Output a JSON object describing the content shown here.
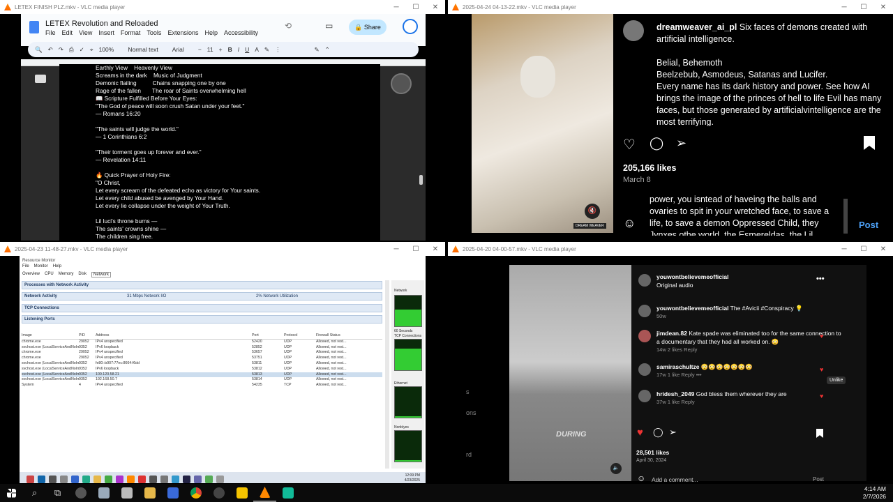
{
  "windows": {
    "w1": {
      "title": "LETEX FINISH PLZ.mkv - VLC media player"
    },
    "w2": {
      "title": "2025-04-24 04-13-22.mkv - VLC media player"
    },
    "w3": {
      "title": "2025-04-23 11-48-27.mkv - VLC media player"
    },
    "w4": {
      "title": "2025-04-20 04-00-57.mkv - VLC media player"
    }
  },
  "docs": {
    "title": "LETEX Revolution and Reloaded",
    "menu": [
      "File",
      "Edit",
      "View",
      "Insert",
      "Format",
      "Tools",
      "Extensions",
      "Help",
      "Accessibility"
    ],
    "share": "Share",
    "zoom": "100%",
    "style": "Normal text",
    "font": "Arial",
    "size": "11",
    "body": "Earthly View    Heavenly View\nScreams in the dark    Music of Judgment\nDemonic flailing          Chains snapping one by one\nRage of the fallen       The roar of Saints overwhelming hell\n📖 Scripture Fulfilled Before Your Eyes:\n\"The God of peace will soon crush Satan under your feet.\"\n— Romans 16:20\n\n\"The saints will judge the world.\"\n— 1 Corinthians 6:2\n\n\"Their torment goes up forever and ever.\"\n— Revelation 14:11\n\n🔥 Quick Prayer of Holy Fire:\n\"O Christ,\nLet every scream of the defeated echo as victory for Your saints.\nLet every child abused be avenged by Your Hand.\nLet every lie collapse under the weight of Your Truth.\n\nLil luci's throne burns —\nThe saints' crowns shine —\nThe children sing free."
  },
  "ig1": {
    "username": "dreamweaver_ai_pl",
    "caption": " Six faces of demons created with artificial intelligence.\n\nBelial, Behemoth\nBeelzebub, Asmodeus, Satanas and Lucifer.\nEvery name has its dark history and power. See how AI brings the image of the princes of hell to life Evil has many faces, but those generated by artificialvintelligence are the most terrifying.",
    "likes": "205,166 likes",
    "date": "March 8",
    "reply": "power, you isntead of haveing the balls and ovaries to spit in your wretched face, to save a life, to save a demon Oppressed Child, they Jynxes othe world, the Esmereldas, the Lil",
    "post": "Post",
    "watermark": "DREAM WEAVER"
  },
  "rm": {
    "title": "Resource Monitor",
    "menu": [
      "File",
      "Monitor",
      "Help"
    ],
    "tabs": [
      "Overview",
      "CPU",
      "Memory",
      "Disk",
      "Network"
    ],
    "sections": [
      "Processes with Network Activity",
      "Network Activity",
      "TCP Connections",
      "Listening Ports"
    ],
    "net_activity": "31 Mbps Network I/O",
    "net_util": "2% Network Utilization",
    "columns": [
      "Image",
      "PID",
      "Address",
      "Port",
      "Protocol",
      "Firewall Status"
    ],
    "rows": [
      [
        "chrome.exe",
        "29052",
        "IPv4 unspecified",
        "52420",
        "UDP",
        "Allowed, not rest..."
      ],
      [
        "svchost.exe (LocalServiceAndNoIm...",
        "9352",
        "IPv6 loopback",
        "52852",
        "UDP",
        "Allowed, not rest..."
      ],
      [
        "chrome.exe",
        "29052",
        "IPv4 unspecified",
        "53657",
        "UDP",
        "Allowed, not rest..."
      ],
      [
        "chrome.exe",
        "29052",
        "IPv4 unspecified",
        "53751",
        "UDP",
        "Allowed, not rest..."
      ],
      [
        "svchost.exe (LocalServiceAndNoIm...",
        "9352",
        "fe80::b907:77ec:8664:f6dd",
        "53811",
        "UDP",
        "Allowed, not rest..."
      ],
      [
        "svchost.exe (LocalServiceAndNoIm...",
        "9352",
        "IPv6 loopback",
        "53812",
        "UDP",
        "Allowed, not rest..."
      ],
      [
        "svchost.exe (LocalServiceAndNoIm...",
        "9352",
        "100.120.58.21",
        "53813",
        "UDP",
        "Allowed, not rest..."
      ],
      [
        "svchost.exe (LocalServiceAndNoIm...",
        "9352",
        "192.168.50.7",
        "53814",
        "UDP",
        "Allowed, not rest..."
      ],
      [
        "System",
        "4",
        "IPv4 unspecified",
        "54235",
        "TCP",
        "Allowed, not rest..."
      ]
    ],
    "graphs": [
      "Network",
      "60 Seconds",
      "TCP Connections",
      "Ethernet",
      "Nonblyes"
    ],
    "graph_levels": [
      0.55,
      0.7,
      0.05,
      0.05
    ],
    "clock": "12:09 PM",
    "date": "4/23/2025"
  },
  "ig2": {
    "header_user": "youwontbelievemeofficial",
    "audio": "Original audio",
    "post_user": "youwontbelievemeofficial",
    "post_caption": "The #Avicii #Conspiracy 💡",
    "post_age": "50w",
    "comments": [
      {
        "user": "jimdean.82",
        "text": "Kate spade was eliminated too for the same connection to a documentary that they had all worked on. 😳",
        "meta": "14w   2 likes   Reply"
      },
      {
        "user": "samiraschultze",
        "text": "😳😳😳😳😳😳😳",
        "meta": "17w   1 like   Reply   •••"
      },
      {
        "user": "hridesh_2049",
        "text": "God bless them wherever they are",
        "meta": "37w   1 like   Reply"
      }
    ],
    "likes": "28,501 likes",
    "date": "April 30, 2024",
    "add_comment": "Add a comment...",
    "post": "Post",
    "unlike": "Unlike",
    "overlay_text": "DURING",
    "side_labels": [
      "s",
      "ons",
      "rd"
    ]
  },
  "taskbar": {
    "time": "4:14 AM",
    "date": "2/7/2026"
  }
}
